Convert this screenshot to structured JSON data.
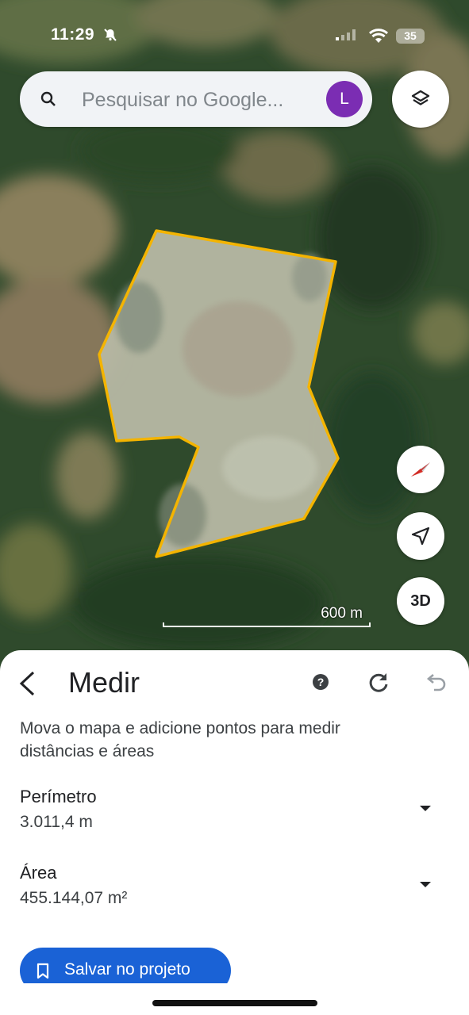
{
  "status_bar": {
    "time": "11:29",
    "battery": "35"
  },
  "search": {
    "placeholder": "Pesquisar no Google...",
    "avatar_letter": "L",
    "avatar_color": "#7b2db3"
  },
  "map": {
    "scale_label": "600 m",
    "three_d_label": "3D",
    "polygon_color": "#f4b400"
  },
  "measure": {
    "title": "Medir",
    "description": "Mova o mapa e adicione pontos para medir distâncias e áreas",
    "perimeter_label": "Perímetro",
    "perimeter_value": "3.011,4 m",
    "area_label": "Área",
    "area_value": "455.144,07 m²",
    "save_label": "Salvar no projeto"
  },
  "colors": {
    "accent": "#1a62d6"
  },
  "icons": [
    "bell-muted-icon",
    "signal-icon",
    "wifi-icon",
    "search-icon",
    "layers-icon",
    "compass-icon",
    "navigation-arrow-icon",
    "back-arrow-icon",
    "help-icon",
    "reset-icon",
    "undo-icon",
    "dropdown-arrow-icon",
    "bookmark-icon"
  ]
}
